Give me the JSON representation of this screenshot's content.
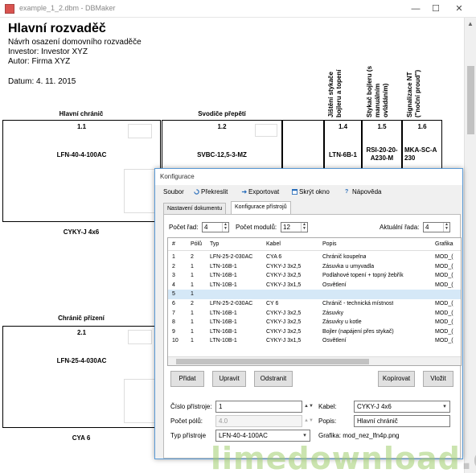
{
  "window": {
    "title": "example_1_2.dbm - DBMaker",
    "minimize": "—",
    "maximize": "☐",
    "close": "✕"
  },
  "document": {
    "title": "Hlavní rozvaděč",
    "subtitle": "Návrh osazení domovního rozvaděče",
    "investor": "Investor: Investor XYZ",
    "author": "Autor: Firma XYZ",
    "date": "Datum: 4. 11. 2015",
    "vertical_headers": [
      "Jištění stykače\nbojleru a topení",
      "Stykač bojleru (s\nmanuálním\novládáním)",
      "Signalizace NT\n(\"noční proud\")"
    ],
    "row1": {
      "groups": [
        {
          "header": "Hlavní chránič",
          "number": "1.1",
          "type": "LFN-40-4-100AC",
          "cable": "CYKY-J 4x6"
        },
        {
          "header": "Svodiče přepětí",
          "number": "1.2",
          "type": "SVBC-12,5-3-MZ",
          "cable": ""
        }
      ],
      "slots": [
        {
          "number": "1.4",
          "type": "LTN-6B-1"
        },
        {
          "number": "1.5",
          "type": "RSI-20-20-\nA230-M"
        },
        {
          "number": "1.6",
          "type": "MKA-SC-A\n230"
        }
      ]
    },
    "row2": {
      "header": "Chránič přízení",
      "number": "2.1",
      "type": "LFN-25-4-030AC",
      "cable": "CYA 6"
    }
  },
  "dialog": {
    "title": "Konfigurace",
    "menu": [
      {
        "label": "Soubor",
        "icon": ""
      },
      {
        "label": "Překreslit",
        "icon": "refresh-icon"
      },
      {
        "label": "Exportovat",
        "icon": "export-icon"
      },
      {
        "label": "Skrýt okno",
        "icon": "window-icon"
      },
      {
        "label": "Nápověda",
        "icon": "help-icon"
      }
    ],
    "tabs": [
      "Nastavení dokumentu",
      "Konfigurace přístrojů"
    ],
    "active_tab": 1,
    "pocet_rad": {
      "label": "Počet řad:",
      "value": "4"
    },
    "pocet_modulu": {
      "label": "Počet modulů:",
      "value": "12"
    },
    "aktualni_rada": {
      "label": "Aktuální řada:",
      "value": "4"
    },
    "table": {
      "columns": [
        "#",
        "Pólů",
        "Typ",
        "Kabel",
        "Popis",
        "Grafika"
      ],
      "rows": [
        [
          "1",
          "2",
          "LFN-25-2-030AC",
          "CYA 6",
          "Chránič koupelna",
          "MOD_("
        ],
        [
          "2",
          "1",
          "LTN-16B-1",
          "CYKY-J 3x2,5",
          "Zásuvka u umyvadla",
          "MOD_("
        ],
        [
          "3",
          "1",
          "LTN-16B-1",
          "CYKY-J 3x2,5",
          "Podlahové topení + topný žebřík",
          "MOD_("
        ],
        [
          "4",
          "1",
          "LTN-10B-1",
          "CYKY-J 3x1,5",
          "Osvětlení",
          "MOD_("
        ],
        [
          "5",
          "1",
          "",
          "",
          "",
          ""
        ],
        [
          "6",
          "2",
          "LFN-25-2-030AC",
          "CY 6",
          "Chránič - technická místnost",
          "MOD_("
        ],
        [
          "7",
          "1",
          "LTN-16B-1",
          "CYKY-J 3x2,5",
          "Zásuvky",
          "MOD_("
        ],
        [
          "8",
          "1",
          "LTN-16B-1",
          "CYKY-J 3x2,5",
          "Zásuvky u kotle",
          "MOD_("
        ],
        [
          "9",
          "1",
          "LTN-16B-1",
          "CYKY-J 3x2,5",
          "Bojler (napájení přes stykač)",
          "MOD_("
        ],
        [
          "10",
          "1",
          "LTN-10B-1",
          "CYKY-J 3x1,5",
          "Osvětlení",
          "MOD_("
        ]
      ],
      "selected_row": 4
    },
    "buttons": {
      "pridat": "Přidat",
      "upravit": "Upravit",
      "odstranit": "Odstranit",
      "kopirovat": "Kopírovat",
      "vlozit": "Vložit"
    },
    "form": {
      "cislo_label": "Číslo přístroje:",
      "cislo_value": "1",
      "polu_label": "Počet pólů:",
      "polu_value": "4.0",
      "typ_label": "Typ přístroje",
      "typ_value": "LFN-40-4-100AC",
      "kabel_label": "Kabel:",
      "kabel_value": "CYKY-J 4x6",
      "popis_label": "Popis:",
      "popis_value": "Hlavní chránič",
      "grafika": "Grafika: mod_nez_lfn4p.png"
    }
  },
  "watermark": {
    "main": "limedownload",
    "tld": ".com"
  }
}
